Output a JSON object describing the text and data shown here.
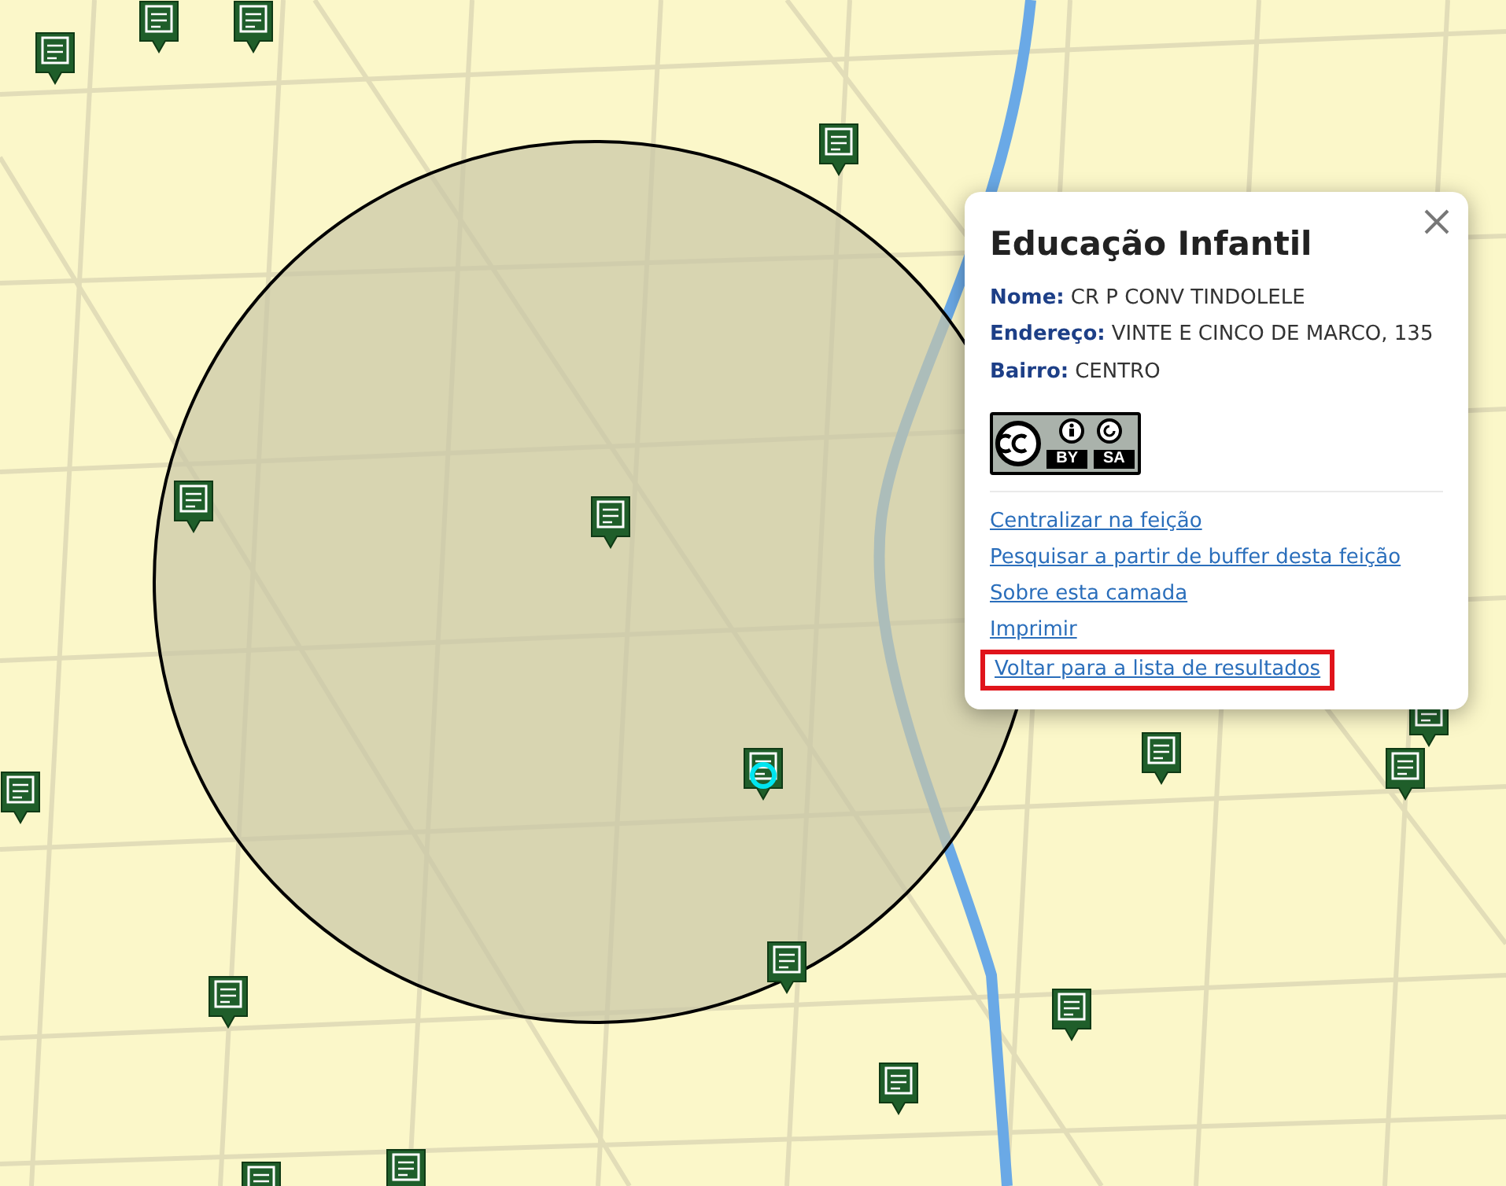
{
  "map": {
    "markers": [
      {
        "selected": false
      },
      {
        "selected": false
      },
      {
        "selected": false
      },
      {
        "selected": false
      },
      {
        "selected": false
      },
      {
        "selected": false
      },
      {
        "selected": true
      },
      {
        "selected": false
      },
      {
        "selected": false
      },
      {
        "selected": false
      },
      {
        "selected": false
      },
      {
        "selected": false
      },
      {
        "selected": false
      },
      {
        "selected": false
      },
      {
        "selected": false
      },
      {
        "selected": false
      },
      {
        "selected": false
      }
    ]
  },
  "popup": {
    "title": "Educação Infantil",
    "fields": [
      {
        "label": "Nome:",
        "value": "CR P CONV TINDOLELE"
      },
      {
        "label": "Endereço:",
        "value": "VINTE E CINCO DE MARCO, 135"
      },
      {
        "label": "Bairro:",
        "value": "CENTRO"
      }
    ],
    "license_badge": {
      "by": "BY",
      "sa": "SA"
    },
    "links": [
      {
        "label": "Centralizar na feição",
        "highlighted": false
      },
      {
        "label": "Pesquisar a partir de buffer desta feição",
        "highlighted": false
      },
      {
        "label": "Sobre esta camada",
        "highlighted": false
      },
      {
        "label": "Imprimir",
        "highlighted": false
      },
      {
        "label": "Voltar para a lista de resultados",
        "highlighted": true
      }
    ]
  }
}
